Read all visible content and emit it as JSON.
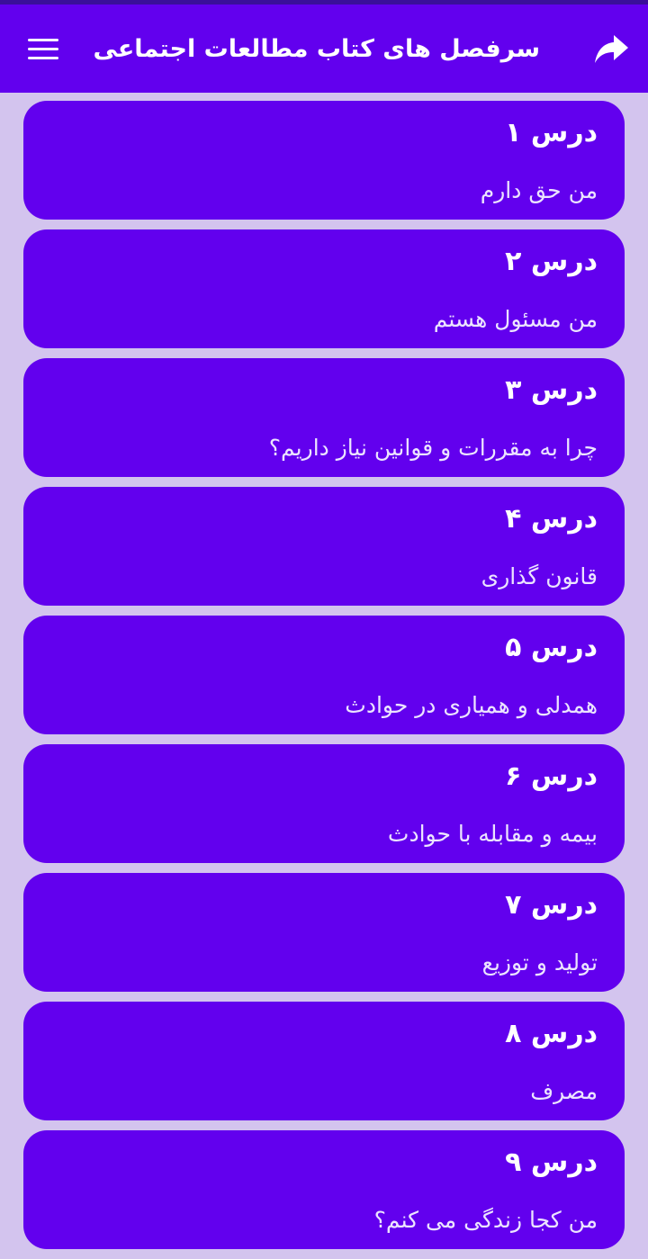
{
  "app_bar": {
    "title": "سرفصل های کتاب مطالعات اجتماعی",
    "menu_icon": "hamburger-menu-icon",
    "share_icon": "share-arrow-icon"
  },
  "colors": {
    "primary": "#6200ee",
    "background": "#d3c4ee",
    "status_bar": "#3a0f9a"
  },
  "lessons": [
    {
      "title": "درس ۱",
      "subtitle": "من حق دارم"
    },
    {
      "title": "درس ۲",
      "subtitle": "من مسئول هستم"
    },
    {
      "title": "درس ۳",
      "subtitle": "چرا به مقررات و قوانین نیاز داریم؟"
    },
    {
      "title": "درس ۴",
      "subtitle": "قانون گذاری"
    },
    {
      "title": "درس ۵",
      "subtitle": "همدلی و همیاری در حوادث"
    },
    {
      "title": "درس ۶",
      "subtitle": "بیمه و مقابله با حوادث"
    },
    {
      "title": "درس ۷",
      "subtitle": "تولید و توزیع"
    },
    {
      "title": "درس ۸",
      "subtitle": "مصرف"
    },
    {
      "title": "درس ۹",
      "subtitle": "من کجا زندگی می کنم؟"
    }
  ]
}
